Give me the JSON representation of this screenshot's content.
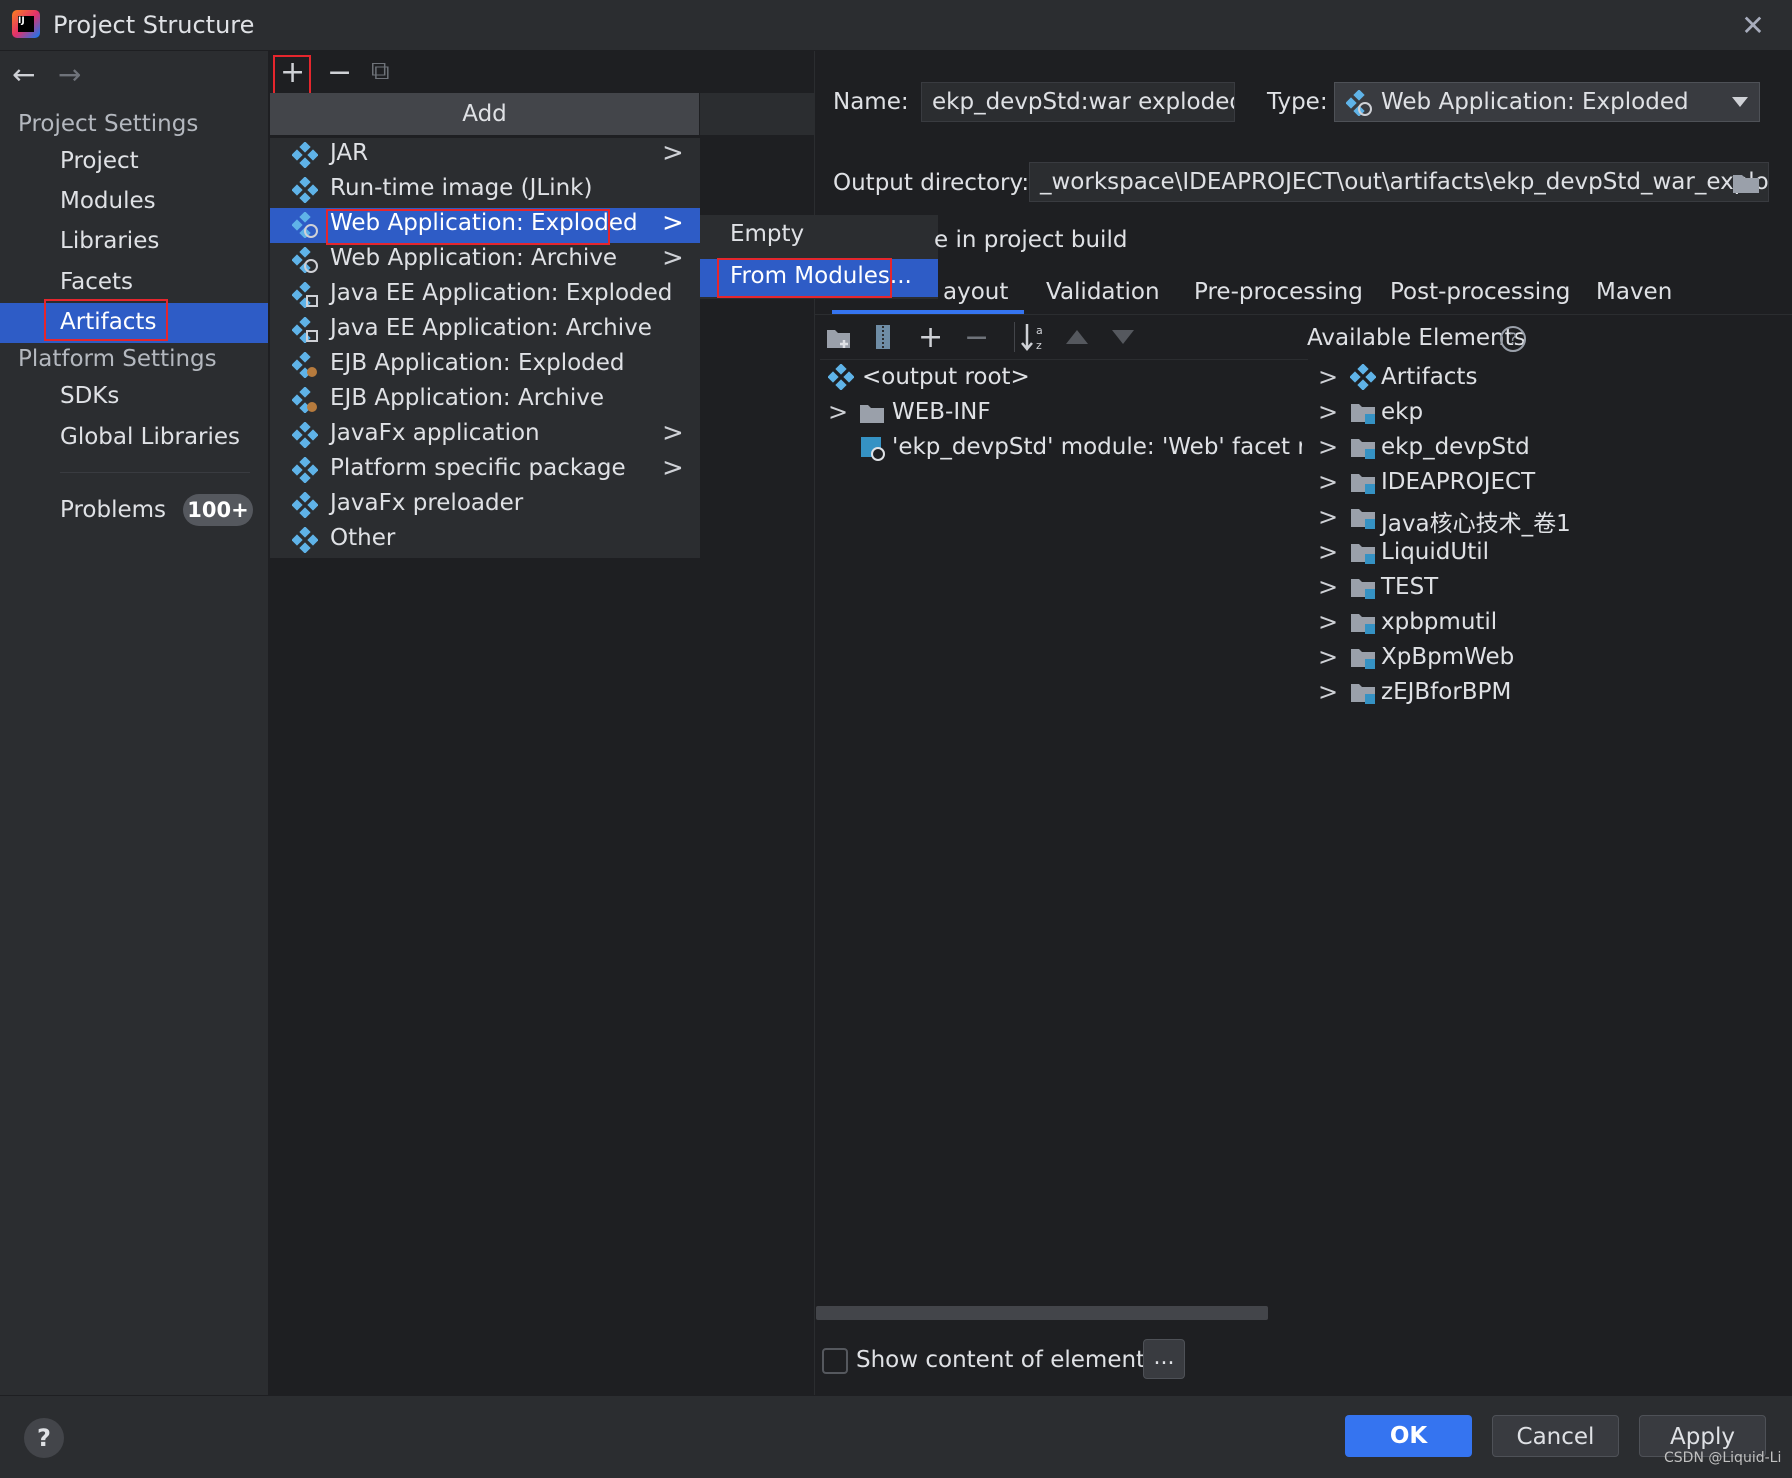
{
  "window": {
    "title": "Project Structure",
    "close_glyph": "✕"
  },
  "nav": {
    "back": "←",
    "forward": "→"
  },
  "sidebar": {
    "project_settings_heading": "Project Settings",
    "items": [
      "Project",
      "Modules",
      "Libraries",
      "Facets",
      "Artifacts"
    ],
    "selected": "Artifacts",
    "platform_settings_heading": "Platform Settings",
    "platform_items": [
      "SDKs",
      "Global Libraries"
    ],
    "problems_label": "Problems",
    "problems_badge": "100+"
  },
  "toolbar": {
    "add": "+",
    "remove": "−",
    "copy": "⧉"
  },
  "add_menu": {
    "header": "Add",
    "items": [
      {
        "label": "JAR",
        "icon": "artifact-icon",
        "submenu": true
      },
      {
        "label": "Run-time image (JLink)",
        "icon": "artifact-icon",
        "submenu": false
      },
      {
        "label": "Web Application: Exploded",
        "icon": "web-app-icon",
        "submenu": true
      },
      {
        "label": "Web Application: Archive",
        "icon": "web-app-icon",
        "submenu": true
      },
      {
        "label": "Java EE Application: Exploded",
        "icon": "javaee-icon",
        "submenu": false
      },
      {
        "label": "Java EE Application: Archive",
        "icon": "javaee-icon",
        "submenu": false
      },
      {
        "label": "EJB Application: Exploded",
        "icon": "ejb-icon",
        "submenu": false
      },
      {
        "label": "EJB Application: Archive",
        "icon": "ejb-icon",
        "submenu": false
      },
      {
        "label": "JavaFx application",
        "icon": "artifact-icon",
        "submenu": true
      },
      {
        "label": "Platform specific package",
        "icon": "artifact-icon",
        "submenu": true
      },
      {
        "label": "JavaFx preloader",
        "icon": "artifact-icon",
        "submenu": false
      },
      {
        "label": "Other",
        "icon": "artifact-icon",
        "submenu": false
      }
    ],
    "selected": "Web Application: Exploded",
    "arrow": ">"
  },
  "submenu": {
    "items": [
      "Empty",
      "From Modules..."
    ],
    "selected": "From Modules..."
  },
  "artifact": {
    "name_label": "Name:",
    "name_value": "ekp_devpStd:war exploded",
    "type_label": "Type:",
    "type_value": "Web Application: Exploded",
    "output_label": "Output directory:",
    "output_value": "_workspace\\IDEAPROJECT\\out\\artifacts\\ekp_devpStd_war_exploded",
    "include_build_partial": "e in project build",
    "tabs": [
      "ayout",
      "Validation",
      "Pre-processing",
      "Post-processing",
      "Maven"
    ],
    "active_tab": "ayout"
  },
  "layout_tree": {
    "rows": [
      {
        "label": "<output root>",
        "icon": "artifact-icon"
      },
      {
        "label": "WEB-INF",
        "icon": "folder-icon"
      },
      {
        "label": "'ekp_devpStd' module: 'Web' facet resour",
        "icon": "web-facet-icon"
      }
    ]
  },
  "available": {
    "heading": "Available Elements",
    "help": "?",
    "items": [
      "Artifacts",
      "ekp",
      "ekp_devpStd",
      "IDEAPROJECT",
      "Java核心技术_卷1",
      "LiquidUtil",
      "TEST",
      "xpbpmutil",
      "XpBpmWeb",
      "zEJBforBPM"
    ]
  },
  "bottom": {
    "show_content_label": "Show content of elements",
    "dots_button": "..."
  },
  "footer": {
    "help": "?",
    "ok": "OK",
    "cancel": "Cancel",
    "apply": "Apply",
    "watermark": "CSDN @Liquid-Li"
  },
  "colors": {
    "accent": "#3574f0",
    "selection": "#2e5cc6",
    "highlight_box": "#e5262d",
    "background": "#1e1f22",
    "panel": "#2b2d30"
  }
}
